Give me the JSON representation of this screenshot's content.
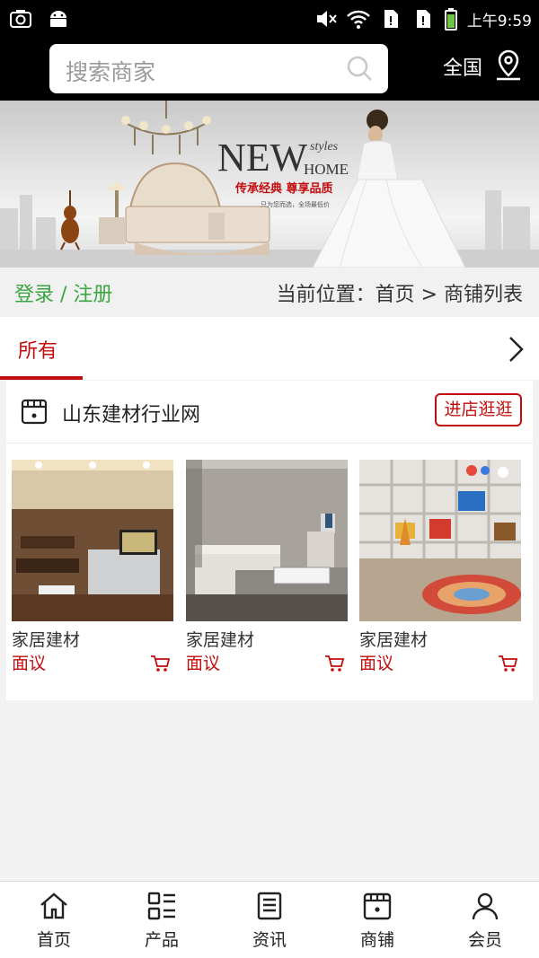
{
  "status_bar": {
    "time": "上午9:59"
  },
  "header": {
    "search_placeholder": "搜索商家",
    "region": "全国"
  },
  "banner": {
    "headline": "NEW",
    "headline_sub_1": "styles",
    "headline_sub_2": "HOME",
    "slogan": "传承经典 尊享品质",
    "tagline": "只为您而选，全场最低价"
  },
  "crumbbar": {
    "login": "登录 / 注册",
    "breadcrumb": "当前位置：首页 > 商铺列表"
  },
  "tabs": {
    "active": "所有"
  },
  "store": {
    "name": "山东建材行业网",
    "enter_button": "进店逛逛",
    "products": [
      {
        "name": "家居建材",
        "price": "面议"
      },
      {
        "name": "家居建材",
        "price": "面议"
      },
      {
        "name": "家居建材",
        "price": "面议"
      }
    ]
  },
  "bottom_nav": [
    {
      "label": "首页",
      "icon": "home-icon"
    },
    {
      "label": "产品",
      "icon": "grid-list-icon"
    },
    {
      "label": "资讯",
      "icon": "news-icon"
    },
    {
      "label": "商铺",
      "icon": "store-icon"
    },
    {
      "label": "会员",
      "icon": "user-icon"
    }
  ],
  "colors": {
    "accent_red": "#c30d0d",
    "login_green": "#3aa640",
    "header_black": "#000000"
  }
}
